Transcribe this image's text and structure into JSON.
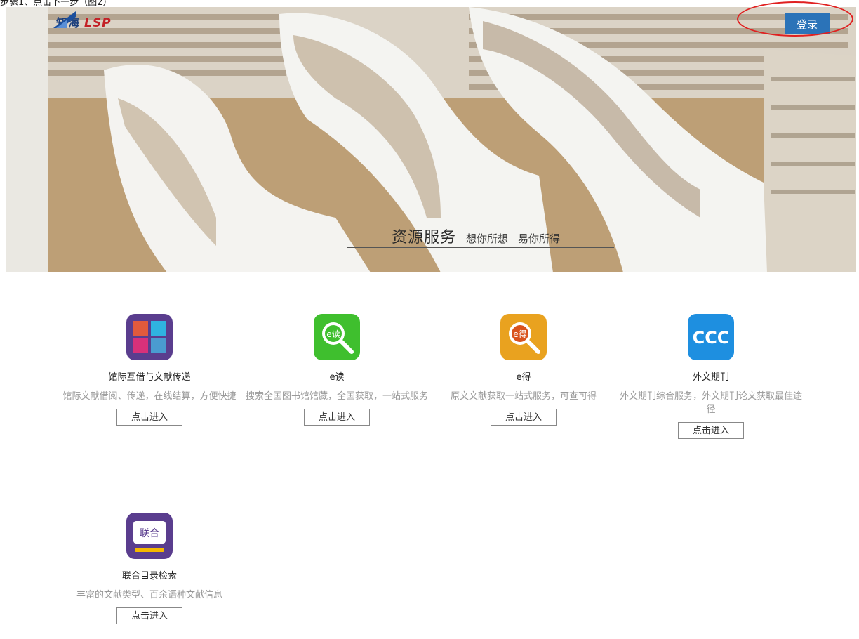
{
  "header": {
    "caption": "步骤1、点击下一步（图2）",
    "logo_text": "知海",
    "logo_brand": "LSP",
    "login_label": "登录"
  },
  "hero": {
    "slogan_main": "资源服务",
    "slogan_sub1": "想你所想",
    "slogan_sub2": "易你所得"
  },
  "services": [
    {
      "title": "馆际互借与文献传递",
      "desc": "馆际文献借阅、传递，在线结算，方便快捷",
      "button": "点击进入",
      "icon": "grid-icon"
    },
    {
      "title": "e读",
      "desc": "搜索全国图书馆馆藏，全国获取，一站式服务",
      "button": "点击进入",
      "icon": "e-read-search-icon"
    },
    {
      "title": "e得",
      "desc": "原文文献获取一站式服务，可查可得",
      "button": "点击进入",
      "icon": "e-de-search-icon"
    },
    {
      "title": "外文期刊",
      "desc": "外文期刊综合服务，外文期刊论文获取最佳途径",
      "button": "点击进入",
      "icon": "ccc-icon",
      "icon_text": "CCC"
    },
    {
      "title": "联合目录检索",
      "desc": "丰富的文献类型、百余语种文献信息",
      "button": "点击进入",
      "icon": "union-catalog-icon",
      "icon_text": "联合"
    }
  ],
  "colors": {
    "login_bg": "#2b73b8",
    "highlight_circle": "#e02020",
    "grid_icon_bg": "#5a3d8e",
    "e_read_bg": "#3fbf2e",
    "e_de_bg": "#e9a21f",
    "ccc_bg": "#1e8fe0",
    "union_bg": "#5a3d8e"
  }
}
